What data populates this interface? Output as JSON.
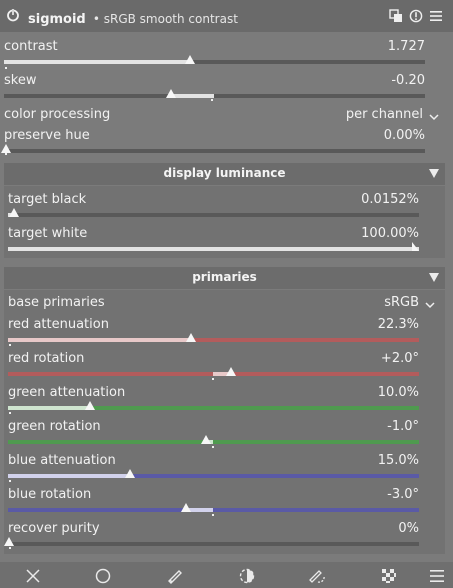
{
  "header": {
    "title": "sigmoid",
    "subtitle": "• sRGB smooth contrast",
    "icons": [
      "power-icon",
      "presets-icon",
      "reset-icon",
      "menu-icon"
    ]
  },
  "controls": {
    "contrast": {
      "label": "contrast",
      "value": "1.727",
      "level": 0.42
    },
    "skew": {
      "label": "skew",
      "value": "-0.20",
      "level": 0.4
    },
    "color_processing": {
      "label": "color processing",
      "value": "per channel"
    },
    "preserve_hue": {
      "label": "preserve hue",
      "value": "0.00%",
      "level": 0.0
    }
  },
  "display_luminance": {
    "title": "display luminance",
    "target_black": {
      "label": "target black",
      "value": "0.0152%",
      "level": 0.015
    },
    "target_white": {
      "label": "target white",
      "value": "100.00%",
      "level": 1.0
    }
  },
  "primaries": {
    "title": "primaries",
    "base_primaries": {
      "label": "base primaries",
      "value": "sRGB"
    },
    "red_attenuation": {
      "label": "red attenuation",
      "value": "22.3%",
      "color": "#b35c5c"
    },
    "red_rotation": {
      "label": "red rotation",
      "value": "+2.0°",
      "color": "#b35c5c"
    },
    "green_attenuation": {
      "label": "green attenuation",
      "value": "10.0%",
      "color": "#4f9a4f"
    },
    "green_rotation": {
      "label": "green rotation",
      "value": "-1.0°",
      "color": "#4f9a4f"
    },
    "blue_attenuation": {
      "label": "blue attenuation",
      "value": "15.0%",
      "color": "#5a5aa6"
    },
    "blue_rotation": {
      "label": "blue rotation",
      "value": "-3.0°",
      "color": "#5a5aa6"
    },
    "recover_purity": {
      "label": "recover purity",
      "value": "0%"
    }
  },
  "colors": {
    "background": "#7b7b7b",
    "header": "#6a6a6a",
    "track": "#595959",
    "fill": "#e3e3e3"
  },
  "bottom_icons": [
    "close-icon",
    "circle-icon",
    "pencil-icon",
    "drawn-parametric-icon",
    "parametric-icon",
    "raster-icon",
    "menu-icon"
  ]
}
